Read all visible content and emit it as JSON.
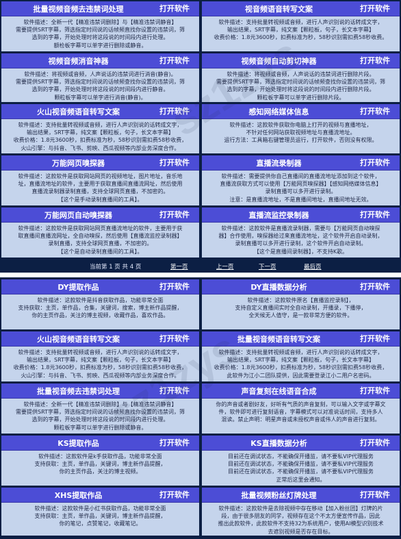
{
  "open_label": "打开软件",
  "top_cards": [
    {
      "title": "批量视频音频去违禁词处理",
      "lines": [
        "软件描述：全新一代【精准违禁词删除】与【精准违禁词静音】",
        "需要提供SRT字幕，筛选指定时间说的话帧频直找你设置的违禁词，筛",
        "选到的字幕，开始处理时将这段说的时间段内进行处理。",
        "额检板字幕可以单字进行删除或静音。"
      ]
    },
    {
      "title": "视音频语音转写文案",
      "lines": [
        "软件描述：支持批量转视频或音频，进行人声识别说的话转成文字，",
        "输出结果，SRT字幕，纯文案【颗粒板，句子，长文本字幕】",
        "收费价格：1.8元3600秒，扣费标准为秒，58秒识别需扣费58秒收费。"
      ]
    },
    {
      "title": "视频音频消音神器",
      "lines": [
        "软件描述：将视频或音频，人声说话的违禁词进行消音(静音)。",
        "需要提供SRT字幕，筛选指定时间说的话帧频查找你设置的违禁词，筛",
        "选到的字幕，开始处理时将这段说的时间段内进行静音。",
        "颗粒板字幕可以单字进行消音(静音)。"
      ]
    },
    {
      "title": "视频音频自动剪切神器",
      "lines": [
        "软件描述：将视频或音频，人声说话的违禁词进行删除片段。",
        "需要提供SRT字幕，筛选指定时间说的话帧频查找你设置的违禁词，筛",
        "选到的字幕，开始处理时将这段说的时间段内进行删除片段。",
        "颗粒板字幕可以单字进行删除片段。"
      ]
    },
    {
      "title": "火山视音频语音转写文案",
      "lines": [
        "软件描述：支持批量转视频或音频，进行人声识别说的话转成文字，",
        "输出结果，SRT字幕，纯文案【颗粒板，句子，长文本字幕】",
        "收费价格：1.8元3600秒，扣费标准为秒，58秒识别需扣费58秒收费，",
        "火山引擎：与抖音、飞书、剪映、西瓜视频等内部业务深度合作。"
      ]
    },
    {
      "title": "感知网络媒体信息",
      "lines": [
        "软件描述：这款软件获取你电脑上打开的视频与直播地址，",
        "不针对任何网站获取视频地址与直播流地址。",
        "运行方法：工具箱右键管理员运行，打开软件，否则没有权限。"
      ]
    },
    {
      "title": "万能网页嗅探器",
      "lines": [
        "软件描述：这款软件是获取网站网页的视频地址，图片地址，音乐地",
        "址，直播流地址的软件，主要用于获取直播间直播流网址，然后使用",
        "直播流录制器录制直播，支持全球网页直播，不加密的。",
        "【这个是手动录制直播间的工具】。"
      ]
    },
    {
      "title": "直播流录制器",
      "lines": [
        "软件描述：需要提供你自己直播间的直播流地址添加到这个软件，",
        "直播流获取方式可以使用【万能网页嗅探器】【感知网络媒体信息】",
        "录制直播可以多开进行录制。",
        "注意：是直播流地址，不是直播间地址，直播间地址无效。"
      ]
    },
    {
      "title": "万能网页自动嗅探器",
      "lines": [
        "软件描述：这款软件是获取网站网页直播流地址的软件，主要用于获",
        "取直播间直播流网址，全自动嗅探，然后使用【直播流监控录制器】",
        "录制直播，支持全球网页直播，不加密的。",
        "【这个是自动录制直播间的工具】。"
      ]
    },
    {
      "title": "直播流监控录制器",
      "lines": [
        "软件描述：这款软件是直播流录制器，需要与【万能网页自动嗅探",
        "器】合作使用，嗅探器给过来直播流地址，这个软件开启自动录制，",
        "录制直播可以多开进行录制，这个软件开启自动录制。",
        "【这个是直播间录制器】，不支持K歌。"
      ]
    }
  ],
  "pager": {
    "page_info": "当前第 1 页 共 4 页",
    "first": "第一页",
    "prev": "上一页",
    "next": "下一页",
    "last": "最后页"
  },
  "bottom_cards": [
    {
      "title": "DY提取作品",
      "lines": [
        "软件描述：这款软件是抖音获取作品，功能非常全面",
        "支持获取：主页，单作品，合集，关键词，搜索，博主新作品提醒，",
        "你的主页作品，关注的博主视频，收藏作品，喜欢作品。"
      ]
    },
    {
      "title": "DY直播数据分析",
      "lines": [
        "软件描述：这款软件原名【直播监控录制】，",
        "支持自定义直播间实时全自动录制，开播录，下播停，",
        "全天候无人值守，是一款非常方便的软件。"
      ]
    },
    {
      "title": "火山视音频语音转写文案",
      "lines": [
        "软件描述：支持批量转视频或音频，进行人声识别说的话转成文字，",
        "输出结果，SRT字幕，纯文案【颗粒板，句子，长文本字幕】",
        "收费价格：1.8元3600秒，扣费标准为秒，58秒识别需扣费58秒收费，",
        "火山引擎：与抖音、飞书、剪映、西瓜视频等内部业务深度合作。"
      ]
    },
    {
      "title": "批量视音频语音转写文案",
      "lines": [
        "软件描述：支持批量转视频或音频，进行人声识别说的话转成文字，",
        "输出结果，SRT字幕，纯文案【颗粒板，句子，长文本字幕】",
        "收费价格：1.8元3600秒，扣费标准为秒，58秒识别需扣费58秒收费，",
        "此软件为江小二团队提供，因此需要登录江小二用户名密码。"
      ]
    },
    {
      "title": "批量视音频去违禁词处理",
      "lines": [
        "软件描述：全新一代【精准违禁词删除】与【精准违禁词静音】",
        "需要提供SRT字幕，筛选指定时间说的话帧频直找你设置的违禁词，筛",
        "选到的字幕，开始处理时将这段说的时间段内进行处理。",
        "颗粒板字幕可以单字进行删除或静音。"
      ]
    },
    {
      "title": "声音复刻在线语音合成",
      "lines": [
        "你的声音或者剧好友，好听有气质的声音复刻，可以输入文字或字幕文",
        "件，软件即可进行复刻语音，字幕模式可以对准说话时间，支持多人",
        "混读。禁止声明：明星声音或未授权声音或伟人的声音进行复刻。"
      ]
    },
    {
      "title": "KS提取作品",
      "lines": [
        "软件描述：这款软件是k手获取作品，功能非常全面",
        "支持获取：主页，单作品，关键词，博主新作品提醒，",
        "你的主页作品，关注的博主视频。"
      ]
    },
    {
      "title": "KS直播数据分析",
      "lines": [
        "目前还在调试状态，不能确保开播监，请不要私VIP代理服务",
        "目前还在调试状态，不能确保开播监，请不要私VIP代理服务",
        "目前还在调试状态，不能确保开播监，请不要私VIP代理服务",
        "正常后这里会通知。"
      ]
    },
    {
      "title": "XHS提取作品",
      "lines": [
        "软件描述：这款软件是小红书获取作品，功能非常全面",
        "支持获取：主页，单作品，关键词，博主新作品提醒，",
        "你的笔记，点赞笔记，收藏笔记。"
      ]
    },
    {
      "title": "批量视频粉丝灯牌处理",
      "lines": [
        "软件描述：这款软件是去除视频中存在移动【加入粉丝团】灯牌的片",
        "段，由于很多朋友的同学，视频存在这个不太方便宣传作品，因此",
        "推出此款软件，此款软件不支持32为系统用户，使用AI模型识别技术",
        "去遮别视频是否存在目标。"
      ]
    }
  ],
  "watermark": "sz1zys"
}
